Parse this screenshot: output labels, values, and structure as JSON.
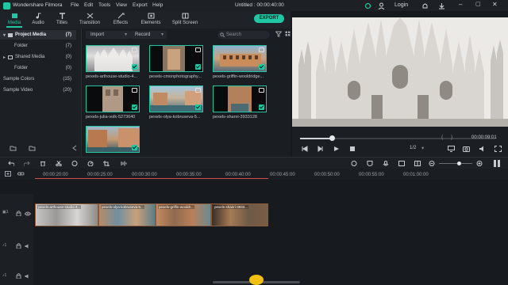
{
  "app": {
    "title": "Wondershare Filmora",
    "document_title": "Untitled : 00:00:40:00",
    "login": "Login"
  },
  "menu": [
    "File",
    "Edit",
    "Tools",
    "View",
    "Export",
    "Help"
  ],
  "toolbar": {
    "tabs": [
      {
        "label": "Media",
        "icon": "media-icon"
      },
      {
        "label": "Audio",
        "icon": "music-icon"
      },
      {
        "label": "Titles",
        "icon": "titles-icon"
      },
      {
        "label": "Transition",
        "icon": "transition-icon"
      },
      {
        "label": "Effects",
        "icon": "effects-icon"
      },
      {
        "label": "Elements",
        "icon": "elements-icon"
      },
      {
        "label": "Split Screen",
        "icon": "split-screen-icon"
      }
    ],
    "export_label": "EXPORT"
  },
  "library": {
    "items": [
      {
        "label": "Project Media",
        "count": "(7)"
      },
      {
        "label": "Folder",
        "count": "(7)"
      },
      {
        "label": "Shared Media",
        "count": "(0)"
      },
      {
        "label": "Folder",
        "count": "(0)"
      },
      {
        "label": "Sample Colors",
        "count": "(15)"
      },
      {
        "label": "Sample Video",
        "count": "(20)"
      }
    ]
  },
  "media": {
    "import_label": "Import",
    "record_label": "Record",
    "search_placeholder": "Search",
    "items": [
      {
        "label": "pexels-arthouse-studio-4..."
      },
      {
        "label": "pexels-cmonphotography..."
      },
      {
        "label": "pexels-griffin-wooldridge..."
      },
      {
        "label": "pexels-julia-volk-5273640"
      },
      {
        "label": "pexels-olya-kobruseva-5..."
      },
      {
        "label": "pexels-shanri-3933128"
      },
      {
        "label": ""
      }
    ]
  },
  "preview": {
    "timecode": "00:00:09:01",
    "quality": "1/2"
  },
  "timeline": {
    "ticks": [
      "00:00:20:00",
      "00:00:25:00",
      "00:00:30:00",
      "00:00:35:00",
      "00:00:40:00",
      "00:00:45:00",
      "00:00:50:00",
      "00:00:55:00",
      "00:01:00:00"
    ],
    "clips": [
      {
        "label": "pexels-arthouse-studio-4..."
      },
      {
        "label": "pexels-olya-kobruseva-5..."
      },
      {
        "label": "pexels-griffin-wooldr..."
      },
      {
        "label": "pexels-shanri-3933..."
      }
    ]
  },
  "colors": {
    "accent": "#20c7a4",
    "background": "#16191e"
  }
}
